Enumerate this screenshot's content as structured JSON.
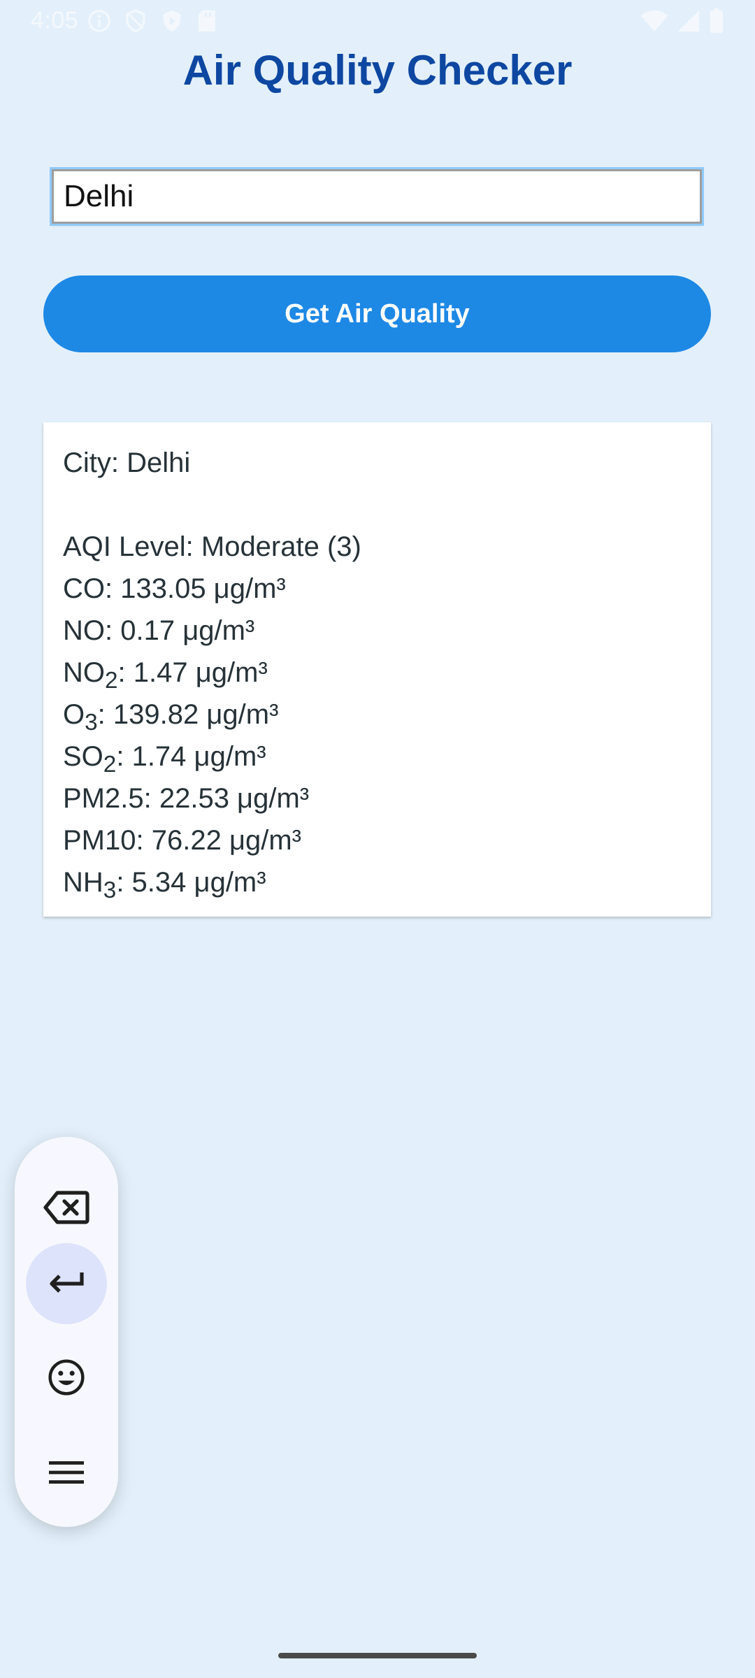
{
  "status_bar": {
    "time": "4:05",
    "left_icons": [
      "info-icon",
      "shield-icon",
      "play-protect-icon",
      "sd-card-icon"
    ],
    "right_icons": [
      "wifi-icon",
      "cell-signal-icon",
      "battery-icon"
    ]
  },
  "app": {
    "title": "Air Quality Checker",
    "title_color": "#0d47a1"
  },
  "search": {
    "value": "Delhi",
    "placeholder": ""
  },
  "action": {
    "button_label": "Get Air Quality",
    "button_color": "#1e88e5"
  },
  "result": {
    "city": "City: Delhi",
    "aqi": "AQI Level: Moderate (3)",
    "pollutants": [
      {
        "name": "CO",
        "sub": "",
        "value": ": 133.05 μg/m³"
      },
      {
        "name": "NO",
        "sub": "",
        "value": ": 0.17 μg/m³"
      },
      {
        "name": "NO",
        "sub": "2",
        "value": ": 1.47 μg/m³"
      },
      {
        "name": "O",
        "sub": "3",
        "value": ": 139.82 μg/m³"
      },
      {
        "name": "SO",
        "sub": "2",
        "value": ": 1.74 μg/m³"
      },
      {
        "name": "PM2.5",
        "sub": "",
        "value": ": 22.53 μg/m³"
      },
      {
        "name": "PM10",
        "sub": "",
        "value": ": 76.22 μg/m³"
      },
      {
        "name": "NH",
        "sub": "3",
        "value": ": 5.34 μg/m³"
      }
    ]
  },
  "keyboard_toolbar": {
    "buttons": [
      "backspace-icon",
      "enter-icon",
      "emoji-icon",
      "menu-icon"
    ],
    "active": "enter-icon"
  }
}
